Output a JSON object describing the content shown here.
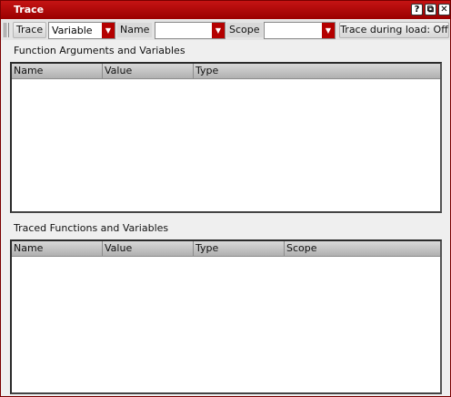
{
  "window": {
    "title": "Trace"
  },
  "titlebar_buttons": {
    "help": "?",
    "restore": "⧉",
    "close": "✕"
  },
  "toolbar": {
    "trace_button": "Trace",
    "trace_combo_value": "Variable",
    "name_label": "Name",
    "name_combo_value": "",
    "scope_label": "Scope",
    "scope_combo_value": "",
    "trace_during_load": "Trace during load: Off"
  },
  "args_section": {
    "label": "Function Arguments and Variables",
    "columns": [
      "Name",
      "Value",
      "Type"
    ],
    "rows": []
  },
  "traced_section": {
    "label": "Traced Functions and Variables",
    "columns": [
      "Name",
      "Value",
      "Type",
      "Scope"
    ],
    "rows": []
  },
  "icons": {
    "combo_arrow": "chevron-down-icon",
    "grip": "toolbar-grip-icon"
  },
  "colors": {
    "titlebar": "#b00000",
    "combo_arrow": "#b40000"
  }
}
